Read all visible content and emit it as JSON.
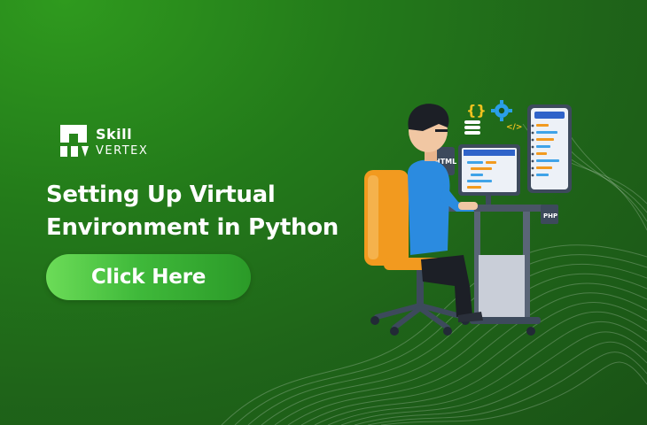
{
  "brand": {
    "line1": "Skill",
    "line2": "VERTEX"
  },
  "headline": {
    "line1": "Setting Up Virtual",
    "line2": "Environment in Python"
  },
  "cta": {
    "label": "Click Here"
  },
  "illustration": {
    "tag_html": "HTML",
    "tag_php": "PHP",
    "icon_braces": "{}",
    "icon_tag": "</>"
  },
  "colors": {
    "background": "#237a1a",
    "button_start": "#6cdc58",
    "button_end": "#2b9a28",
    "chair": "#f29a1f",
    "shirt": "#2b8be0",
    "monitor_screen": "#2f63c9"
  }
}
